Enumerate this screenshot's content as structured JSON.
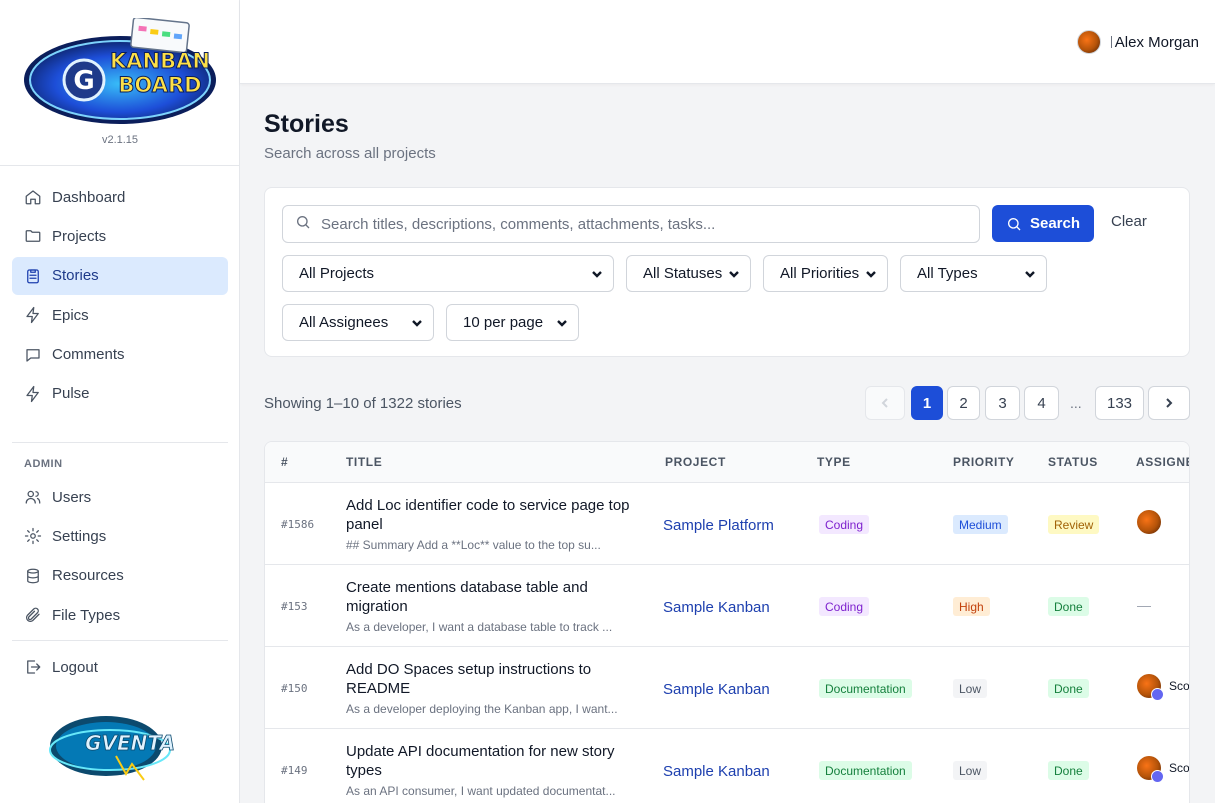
{
  "app": {
    "version": "v2.1.15",
    "logo_text_top": "KANBAN",
    "logo_text_bottom": "BOARD",
    "logo_letter": "G",
    "bottom_logo_text": "GVENTA"
  },
  "sidebar": {
    "items": [
      {
        "label": "Dashboard",
        "icon": "home-icon",
        "active": false
      },
      {
        "label": "Projects",
        "icon": "folder-icon",
        "active": false
      },
      {
        "label": "Stories",
        "icon": "clipboard-icon",
        "active": true
      },
      {
        "label": "Epics",
        "icon": "lightning-icon",
        "active": false
      },
      {
        "label": "Comments",
        "icon": "chat-bubble-icon",
        "active": false
      },
      {
        "label": "Pulse",
        "icon": "lightning-icon",
        "active": false
      }
    ],
    "admin_label": "ADMIN",
    "admin_items": [
      {
        "label": "Users",
        "icon": "users-icon"
      },
      {
        "label": "Settings",
        "icon": "gear-icon"
      },
      {
        "label": "Resources",
        "icon": "database-icon"
      },
      {
        "label": "File Types",
        "icon": "paperclip-icon"
      }
    ],
    "logout_label": "Logout"
  },
  "header": {
    "user_name": "Alex Morgan"
  },
  "page": {
    "title": "Stories",
    "subtitle": "Search across all projects"
  },
  "filters": {
    "search_placeholder": "Search titles, descriptions, comments, attachments, tasks...",
    "search_button": "Search",
    "clear_button": "Clear",
    "project": "All Projects",
    "status": "All Statuses",
    "priority": "All Priorities",
    "type": "All Types",
    "assignee": "All Assignees",
    "per_page": "10 per page"
  },
  "results": {
    "showing": "Showing 1–10 of 1322 stories",
    "pages": [
      "1",
      "2",
      "3",
      "4"
    ],
    "ellipsis": "...",
    "last_page": "133",
    "current_page": "1"
  },
  "table": {
    "columns": [
      "#",
      "TITLE",
      "PROJECT",
      "TYPE",
      "PRIORITY",
      "STATUS",
      "ASSIGNEE"
    ],
    "rows": [
      {
        "id": "#1586",
        "title": "Add Loc identifier code to service page top panel",
        "summary": "## Summary Add a **Loc** value to the top su...",
        "project": "Sample Platform",
        "type": "Coding",
        "priority": "Medium",
        "status": "Review",
        "assignee": ""
      },
      {
        "id": "#153",
        "title": "Create mentions database table and migration",
        "summary": "As a developer, I want a database table to track ...",
        "project": "Sample Kanban",
        "type": "Coding",
        "priority": "High",
        "status": "Done",
        "assignee": "—"
      },
      {
        "id": "#150",
        "title": "Add DO Spaces setup instructions to README",
        "summary": "As a developer deploying the Kanban app, I want...",
        "project": "Sample Kanban",
        "type": "Documentation",
        "priority": "Low",
        "status": "Done",
        "assignee": "Scout"
      },
      {
        "id": "#149",
        "title": "Update API documentation for new story types",
        "summary": "As an API consumer, I want updated documentat...",
        "project": "Sample Kanban",
        "type": "Documentation",
        "priority": "Low",
        "status": "Done",
        "assignee": "Scout"
      }
    ]
  }
}
